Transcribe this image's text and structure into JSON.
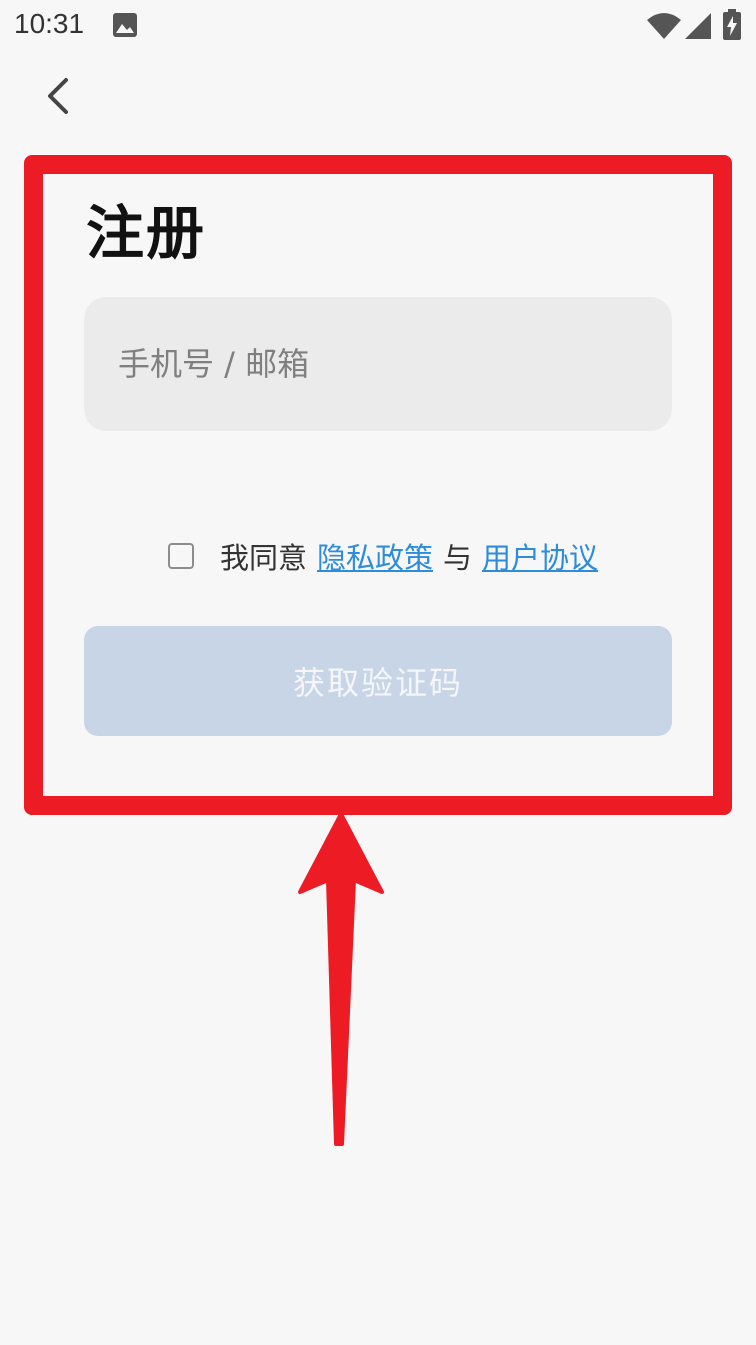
{
  "status_bar": {
    "time": "10:31"
  },
  "nav": {
    "back_icon": "chevron-left-icon"
  },
  "form": {
    "title": "注册",
    "account_placeholder": "手机号 / 邮箱",
    "account_value": "",
    "agreement": {
      "prefix": "我同意",
      "privacy_link": "隐私政策",
      "conjunction": "与",
      "terms_link": "用户协议",
      "checked": false
    },
    "submit_label": "获取验证码",
    "submit_enabled": false
  },
  "colors": {
    "background": "#f7f7f7",
    "input_bg": "#ebebeb",
    "link": "#2d8cdc",
    "button_disabled": "#c8d5e7",
    "annotation": "#ed1c24"
  }
}
